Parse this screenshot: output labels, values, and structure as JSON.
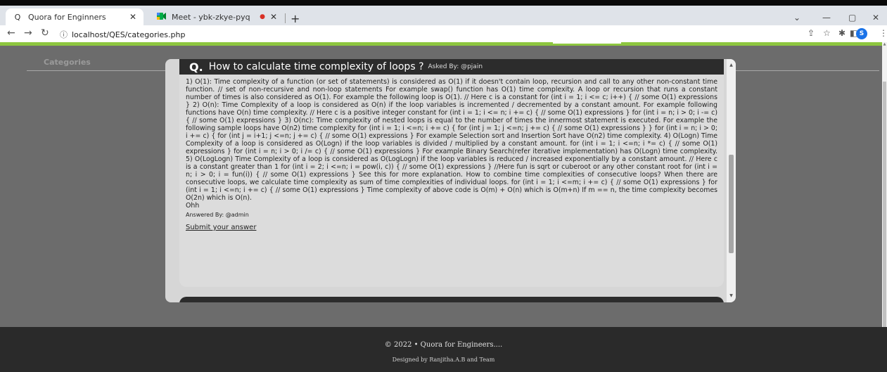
{
  "browser": {
    "tabs": [
      {
        "label": "Quora for Enginners",
        "favicon": "Q"
      },
      {
        "label": "Meet - ybk-zkye-pyq",
        "favicon": "meet-icon"
      }
    ],
    "new_tab": "+",
    "url": "localhost/QES/categories.php",
    "profile_initial": "S"
  },
  "page": {
    "categories_label": "Categories"
  },
  "question": {
    "q_mark": "Q.",
    "title": "How to calculate time complexity of loops ?",
    "asked_by": "Asked By: @pjain",
    "answer_text": "1) O(1): Time complexity of a function (or set of statements) is considered as O(1) if it doesn't contain loop, recursion and call to any other non-constant time function. // set of non-recursive and non-loop statements For example swap() function has O(1) time complexity. A loop or recursion that runs a constant number of times is also considered as O(1). For example the following loop is O(1). // Here c is a constant for (int i = 1; i <= c; i++) { // some O(1) expressions } 2) O(n): Time Complexity of a loop is considered as O(n) if the loop variables is incremented / decremented by a constant amount. For example following functions have O(n) time complexity. // Here c is a positive integer constant for (int i = 1; i <= n; i += c) { // some O(1) expressions } for (int i = n; i > 0; i -= c) { // some O(1) expressions } 3) O(nc): Time complexity of nested loops is equal to the number of times the innermost statement is executed. For example the following sample loops have O(n2) time complexity for (int i = 1; i <=n; i += c) { for (int j = 1; j <=n; j += c) { // some O(1) expressions } } for (int i = n; i > 0; i += c) { for (int j = i+1; j <=n; j += c) { // some O(1) expressions } For example Selection sort and Insertion Sort have O(n2) time complexity. 4) O(Logn) Time Complexity of a loop is considered as O(Logn) if the loop variables is divided / multiplied by a constant amount. for (int i = 1; i <=n; i *= c) { // some O(1) expressions } for (int i = n; i > 0; i /= c) { // some O(1) expressions } For example Binary Search(refer iterative implementation) has O(Logn) time complexity. 5) O(LogLogn) Time Complexity of a loop is considered as O(LogLogn) if the loop variables is reduced / increased exponentially by a constant amount. // Here c is a constant greater than 1 for (int i = 2; i <=n; i = pow(i, c)) { // some O(1) expressions } //Here fun is sqrt or cuberoot or any other constant root for (int i = n; i > 0; i = fun(i)) { // some O(1) expressions } See this for more explanation. How to combine time complexities of consecutive loops? When there are consecutive loops, we calculate time complexity as sum of time complexities of individual loops. for (int i = 1; i <=m; i += c) { // some O(1) expressions } for (int i = 1; i <=n; i += c) { // some O(1) expressions } Time complexity of above code is O(m) + O(n) which is O(m+n) If m == n, the time complexity becomes O(2n) which is O(n).",
    "answer_short": "Ohh",
    "answered_by": "Answered By: @admin",
    "submit_label": "Submit your answer"
  },
  "footer": {
    "line1": "© 2022 • Quora for Engineers....",
    "line2": "Designed by Ranjitha.A.B and Team"
  },
  "colors": {
    "accent_green": "#8dc63f",
    "header_dark": "#2c2c2c",
    "page_bg": "#6c6c6c"
  }
}
